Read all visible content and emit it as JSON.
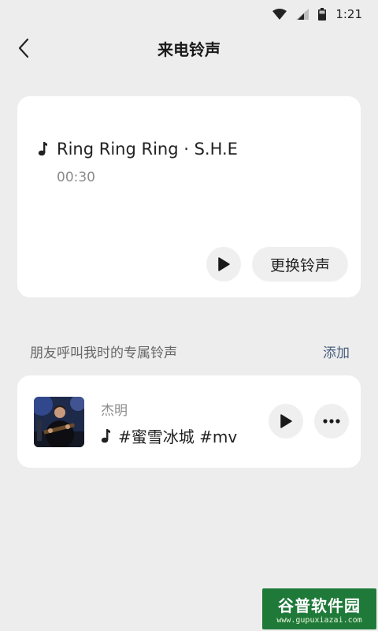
{
  "status_bar": {
    "time": "1:21",
    "icons": [
      "wifi-icon",
      "signal-icon",
      "battery-icon"
    ]
  },
  "header": {
    "title": "来电铃声",
    "back_icon": "chevron-left-icon"
  },
  "ringtone": {
    "title": "Ring Ring Ring · S.H.E",
    "duration": "00:30",
    "change_label": "更换铃声",
    "note_icon": "music-note-icon",
    "play_icon": "play-icon"
  },
  "section": {
    "title": "朋友呼叫我时的专属铃声",
    "add_label": "添加"
  },
  "friend": {
    "name": "杰明",
    "song": "#蜜雪冰城 #mv",
    "avatar": "avatar-photo",
    "play_icon": "play-icon",
    "more_icon": "more-icon"
  },
  "watermark": {
    "brand": "谷普软件园",
    "url": "www.gupuxiazai.com"
  },
  "colors": {
    "background": "#ededed",
    "card": "#ffffff",
    "accent_link": "#4a5f7f",
    "watermark": "#1f7a3a"
  }
}
